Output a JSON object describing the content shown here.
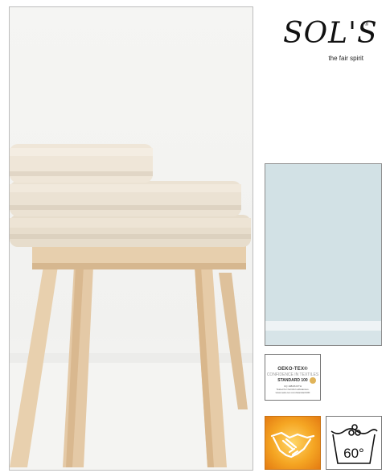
{
  "brand": {
    "logo_text": "SOL'S",
    "registered_mark": "®",
    "tagline": "the fair spirit"
  },
  "photo": {
    "subject": "stack-of-towels-on-wooden-stool"
  },
  "swatch": {
    "color": "#d2e1e5"
  },
  "certification": {
    "title": "OEKO-TEX®",
    "subtitle": "CONFIDENCE IN TEXTILES",
    "standard": "STANDARD 100",
    "code": "CQ 1084/6 IFTH",
    "line1": "Tested for harmful substances.",
    "line2": "www.oeko-tex.com/standard100"
  },
  "badges": {
    "fair_icon": "handshake-icon",
    "fair_color": "#f5a623",
    "wash_icon": "wash-icon",
    "wash_temperature": "60°"
  }
}
